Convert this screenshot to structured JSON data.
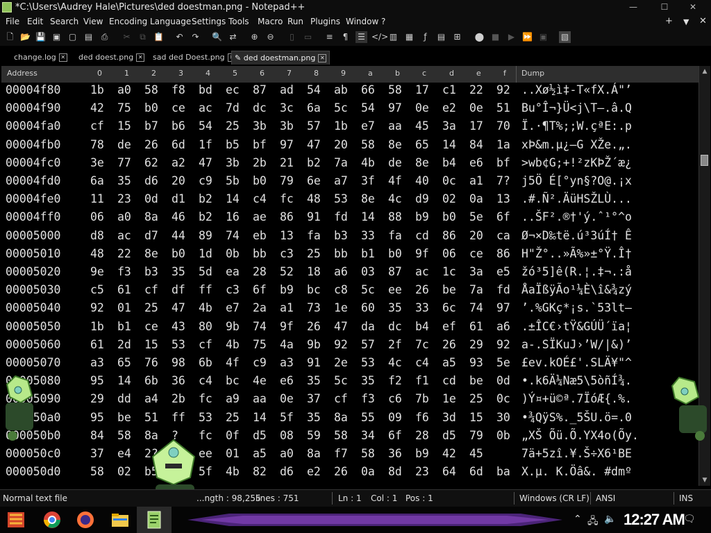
{
  "window": {
    "title": "*C:\\Users\\Audrey Hale\\Pictures\\ded doestman.png - Notepad++",
    "minimize": "—",
    "maximize": "☐",
    "close": "✕"
  },
  "menu": {
    "items": [
      "File",
      "Edit",
      "Search",
      "View",
      "Encoding",
      "Language",
      "Settings",
      "Tools",
      "Macro",
      "Run",
      "Plugins",
      "Window",
      "?"
    ],
    "right_plus": "+",
    "right_down": "▼",
    "right_close": "✕"
  },
  "tabs": [
    {
      "label": "change.log",
      "active": false
    },
    {
      "label": "ded doest.png",
      "active": false
    },
    {
      "label": "sad ded Doest.png",
      "active": false
    },
    {
      "label": "ded doestman.png",
      "active": true
    }
  ],
  "hex_header": {
    "address": "Address",
    "cols": [
      "0",
      "1",
      "2",
      "3",
      "4",
      "5",
      "6",
      "7",
      "8",
      "9",
      "a",
      "b",
      "c",
      "d",
      "e",
      "f"
    ],
    "dump": "Dump"
  },
  "hex_rows": [
    {
      "addr": "00004f80",
      "bytes": [
        "1b",
        "a0",
        "58",
        "f8",
        "bd",
        "ec",
        "87",
        "ad",
        "54",
        "ab",
        "66",
        "58",
        "17",
        "c1",
        "22",
        "92"
      ],
      "dump": "..Xø½ì‡-T«fX.Á\"’"
    },
    {
      "addr": "00004f90",
      "bytes": [
        "42",
        "75",
        "b0",
        "ce",
        "ac",
        "7d",
        "dc",
        "3c",
        "6a",
        "5c",
        "54",
        "97",
        "0e",
        "e2",
        "0e",
        "51"
      ],
      "dump": "Bu°Î¬}Ü<j\\T—.â.Q"
    },
    {
      "addr": "00004fa0",
      "bytes": [
        "cf",
        "15",
        "b7",
        "b6",
        "54",
        "25",
        "3b",
        "3b",
        "57",
        "1b",
        "e7",
        "aa",
        "45",
        "3a",
        "17",
        "70"
      ],
      "dump": "Ï.·¶T%;;W.çªE:.p"
    },
    {
      "addr": "00004fb0",
      "bytes": [
        "78",
        "de",
        "26",
        "6d",
        "1f",
        "b5",
        "bf",
        "97",
        "47",
        "20",
        "58",
        "8e",
        "65",
        "14",
        "84",
        "1a"
      ],
      "dump": "xÞ&m.µ¿—G XŽe.„."
    },
    {
      "addr": "00004fc0",
      "bytes": [
        "3e",
        "77",
        "62",
        "a2",
        "47",
        "3b",
        "2b",
        "21",
        "b2",
        "7a",
        "4b",
        "de",
        "8e",
        "b4",
        "e6",
        "bf"
      ],
      "dump": ">wb¢G;+!²zKÞŽ´æ¿"
    },
    {
      "addr": "00004fd0",
      "bytes": [
        "6a",
        "35",
        "d6",
        "20",
        "c9",
        "5b",
        "b0",
        "79",
        "6e",
        "a7",
        "3f",
        "4f",
        "40",
        "0c",
        "a1",
        "7?"
      ],
      "dump": "j5Ö É[°yn§?O@.¡x"
    },
    {
      "addr": "00004fe0",
      "bytes": [
        "11",
        "23",
        "0d",
        "d1",
        "b2",
        "14",
        "c4",
        "fc",
        "48",
        "53",
        "8e",
        "4c",
        "d9",
        "02",
        "0a",
        "13"
      ],
      "dump": ".#.Ñ².ÄüHSŽLÙ..."
    },
    {
      "addr": "00004ff0",
      "bytes": [
        "06",
        "a0",
        "8a",
        "46",
        "b2",
        "16",
        "ae",
        "86",
        "91",
        "fd",
        "14",
        "88",
        "b9",
        "b0",
        "5e",
        "6f"
      ],
      "dump": "..ŠF².®†'ý.ˆ¹°^o"
    },
    {
      "addr": "00005000",
      "bytes": [
        "d8",
        "ac",
        "d7",
        "44",
        "89",
        "74",
        "eb",
        "13",
        "fa",
        "b3",
        "33",
        "fa",
        "cd",
        "86",
        "20",
        "ca"
      ],
      "dump": "Ø¬×D‰të.ú³3úÍ† Ê"
    },
    {
      "addr": "00005010",
      "bytes": [
        "48",
        "22",
        "8e",
        "b0",
        "1d",
        "0b",
        "bb",
        "c3",
        "25",
        "bb",
        "b1",
        "b0",
        "9f",
        "06",
        "ce",
        "86"
      ],
      "dump": "H\"Ž°..»Ã%»±°Ÿ.Î†"
    },
    {
      "addr": "00005020",
      "bytes": [
        "9e",
        "f3",
        "b3",
        "35",
        "5d",
        "ea",
        "28",
        "52",
        "18",
        "a6",
        "03",
        "87",
        "ac",
        "1c",
        "3a",
        "e5"
      ],
      "dump": "žó³5]ê(R.¦.‡¬.:å"
    },
    {
      "addr": "00005030",
      "bytes": [
        "c5",
        "61",
        "cf",
        "df",
        "ff",
        "c3",
        "6f",
        "b9",
        "bc",
        "c8",
        "5c",
        "ee",
        "26",
        "be",
        "7a",
        "fd"
      ],
      "dump": "ÅaÏßÿÃo¹¼È\\î&¾zý"
    },
    {
      "addr": "00005040",
      "bytes": [
        "92",
        "01",
        "25",
        "47",
        "4b",
        "e7",
        "2a",
        "a1",
        "73",
        "1e",
        "60",
        "35",
        "33",
        "6c",
        "74",
        "97"
      ],
      "dump": "’.%GKç*¡s.`53lt—"
    },
    {
      "addr": "00005050",
      "bytes": [
        "1b",
        "b1",
        "ce",
        "43",
        "80",
        "9b",
        "74",
        "9f",
        "26",
        "47",
        "da",
        "dc",
        "b4",
        "ef",
        "61",
        "a6"
      ],
      "dump": ".±ÎC€›tŸ&GÚÜ´ïa¦"
    },
    {
      "addr": "00005060",
      "bytes": [
        "61",
        "2d",
        "15",
        "53",
        "cf",
        "4b",
        "75",
        "4a",
        "9b",
        "92",
        "57",
        "2f",
        "7c",
        "26",
        "29",
        "92"
      ],
      "dump": "a-.SÏKuJ›’W/|&)’"
    },
    {
      "addr": "00005070",
      "bytes": [
        "a3",
        "65",
        "76",
        "98",
        "6b",
        "4f",
        "c9",
        "a3",
        "91",
        "2e",
        "53",
        "4c",
        "c4",
        "a5",
        "93",
        "5e"
      ],
      "dump": "£ev.kOÉ£'.SLÄ¥\"^"
    },
    {
      "addr": "00005080",
      "bytes": [
        "95",
        "14",
        "6b",
        "36",
        "c4",
        "bc",
        "4e",
        "e6",
        "35",
        "5c",
        "35",
        "f2",
        "f1",
        "cd",
        "be",
        "0d"
      ],
      "dump": "•.k6Ä¼Næ5\\5òñÍ¾."
    },
    {
      "addr": "00005090",
      "bytes": [
        "29",
        "dd",
        "a4",
        "2b",
        "fc",
        "a9",
        "aa",
        "0e",
        "37",
        "cf",
        "f3",
        "c6",
        "7b",
        "1e",
        "25",
        "0c"
      ],
      "dump": ")Ý¤+ü©ª.7ÏóÆ{.%."
    },
    {
      "addr": "000050a0",
      "bytes": [
        "95",
        "be",
        "51",
        "ff",
        "53",
        "25",
        "14",
        "5f",
        "35",
        "8a",
        "55",
        "09",
        "f6",
        "3d",
        "15",
        "30"
      ],
      "dump": "•¾QÿS%._5ŠU.ö=.0"
    },
    {
      "addr": "000050b0",
      "bytes": [
        "84",
        "58",
        "8a",
        "?",
        "fc",
        "0f",
        "d5",
        "08",
        "59",
        "58",
        "34",
        "6f",
        "28",
        "d5",
        "79",
        "0b"
      ],
      "dump": "„XŠ Õü.Õ.YX4o(Õy."
    },
    {
      "addr": "000050c0",
      "bytes": [
        "37",
        "e4",
        "2?",
        "?a",
        "ee",
        "01",
        "a5",
        "a0",
        "8a",
        "f7",
        "58",
        "36",
        "b9",
        "42",
        "45"
      ],
      "dump": "7ä+5zî.¥.Š÷X6¹BE"
    },
    {
      "addr": "000050d0",
      "bytes": [
        "58",
        "02",
        "b5",
        "",
        "5f",
        "4b",
        "82",
        "d6",
        "e2",
        "26",
        "0a",
        "8d",
        "23",
        "64",
        "6d",
        "ba"
      ],
      "dump": "X.µ. K.Öâ&. #dmº"
    }
  ],
  "status": {
    "type": "Normal text file",
    "length": "...ngth : 98,255",
    "lines": "lines : 751",
    "ln": "Ln : 1",
    "col": "Col : 1",
    "pos": "Pos : 1",
    "eol": "Windows (CR LF)",
    "encoding": "ANSI",
    "mode": "INS"
  },
  "taskbar": {
    "clock": "12:27 AM",
    "apps": [
      "start",
      "chrome",
      "firefox",
      "file-explorer",
      "notepad-plus-plus"
    ]
  },
  "colors": {
    "background": "#000000",
    "text": "#e0e0e0",
    "mascot_green": "#8fd16b",
    "taskbar_purple": "#5a2b8a"
  }
}
